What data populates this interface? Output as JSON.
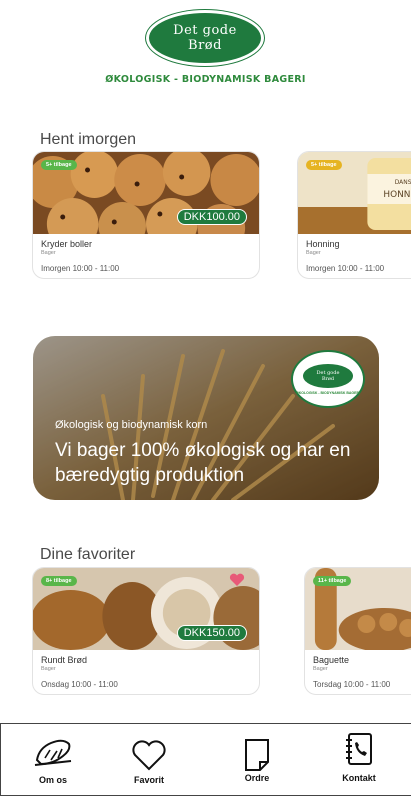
{
  "brand": {
    "logo_line1": "Det gode",
    "logo_line2": "Brød",
    "tagline": "ØKOLOGISK - BIODYNAMISK BAGERI"
  },
  "sections": {
    "pickup_title": "Hent imorgen",
    "favorites_title": "Dine favoriter"
  },
  "pickup_cards": [
    {
      "badge": "5+ tilbage",
      "badge_color": "#59b64a",
      "price": "DKK100.00",
      "name": "Kryder boller",
      "category": "Bager",
      "time": "Imorgen 10:00 - 11:00"
    },
    {
      "badge": "5+ tilbage",
      "badge_color": "#e6b422",
      "price": "",
      "name": "Honning",
      "category": "Bager",
      "time": "Imorgen 10:00 - 11:00"
    }
  ],
  "banner": {
    "subtitle": "Økologisk og biodynamisk korn",
    "title": "Vi bager 100% økologisk og har en bæredygtig produktion",
    "logo_line1": "Det gode",
    "logo_line2": "Brød",
    "logo_tagline": "ØKOLOGISK - BIODYNAMISK BAGERI"
  },
  "favorite_cards": [
    {
      "badge": "8+ tilbage",
      "badge_color": "#59b64a",
      "price": "DKK150.00",
      "name": "Rundt Brød",
      "category": "Bager",
      "time": "Onsdag 10:00 - 11:00",
      "favorited": true
    },
    {
      "badge": "11+ tilbage",
      "badge_color": "#59b64a",
      "price": "",
      "name": "Baguette",
      "category": "Bager",
      "time": "Torsdag 10:00 - 11:00",
      "favorited": false
    }
  ],
  "nav": {
    "about": "Om os",
    "favorite": "Favorit",
    "orders": "Ordre",
    "contact": "Kontakt"
  },
  "colors": {
    "brand_green": "#1f7a3e",
    "badge_green": "#59b64a",
    "heart_pink": "#e85a78"
  }
}
